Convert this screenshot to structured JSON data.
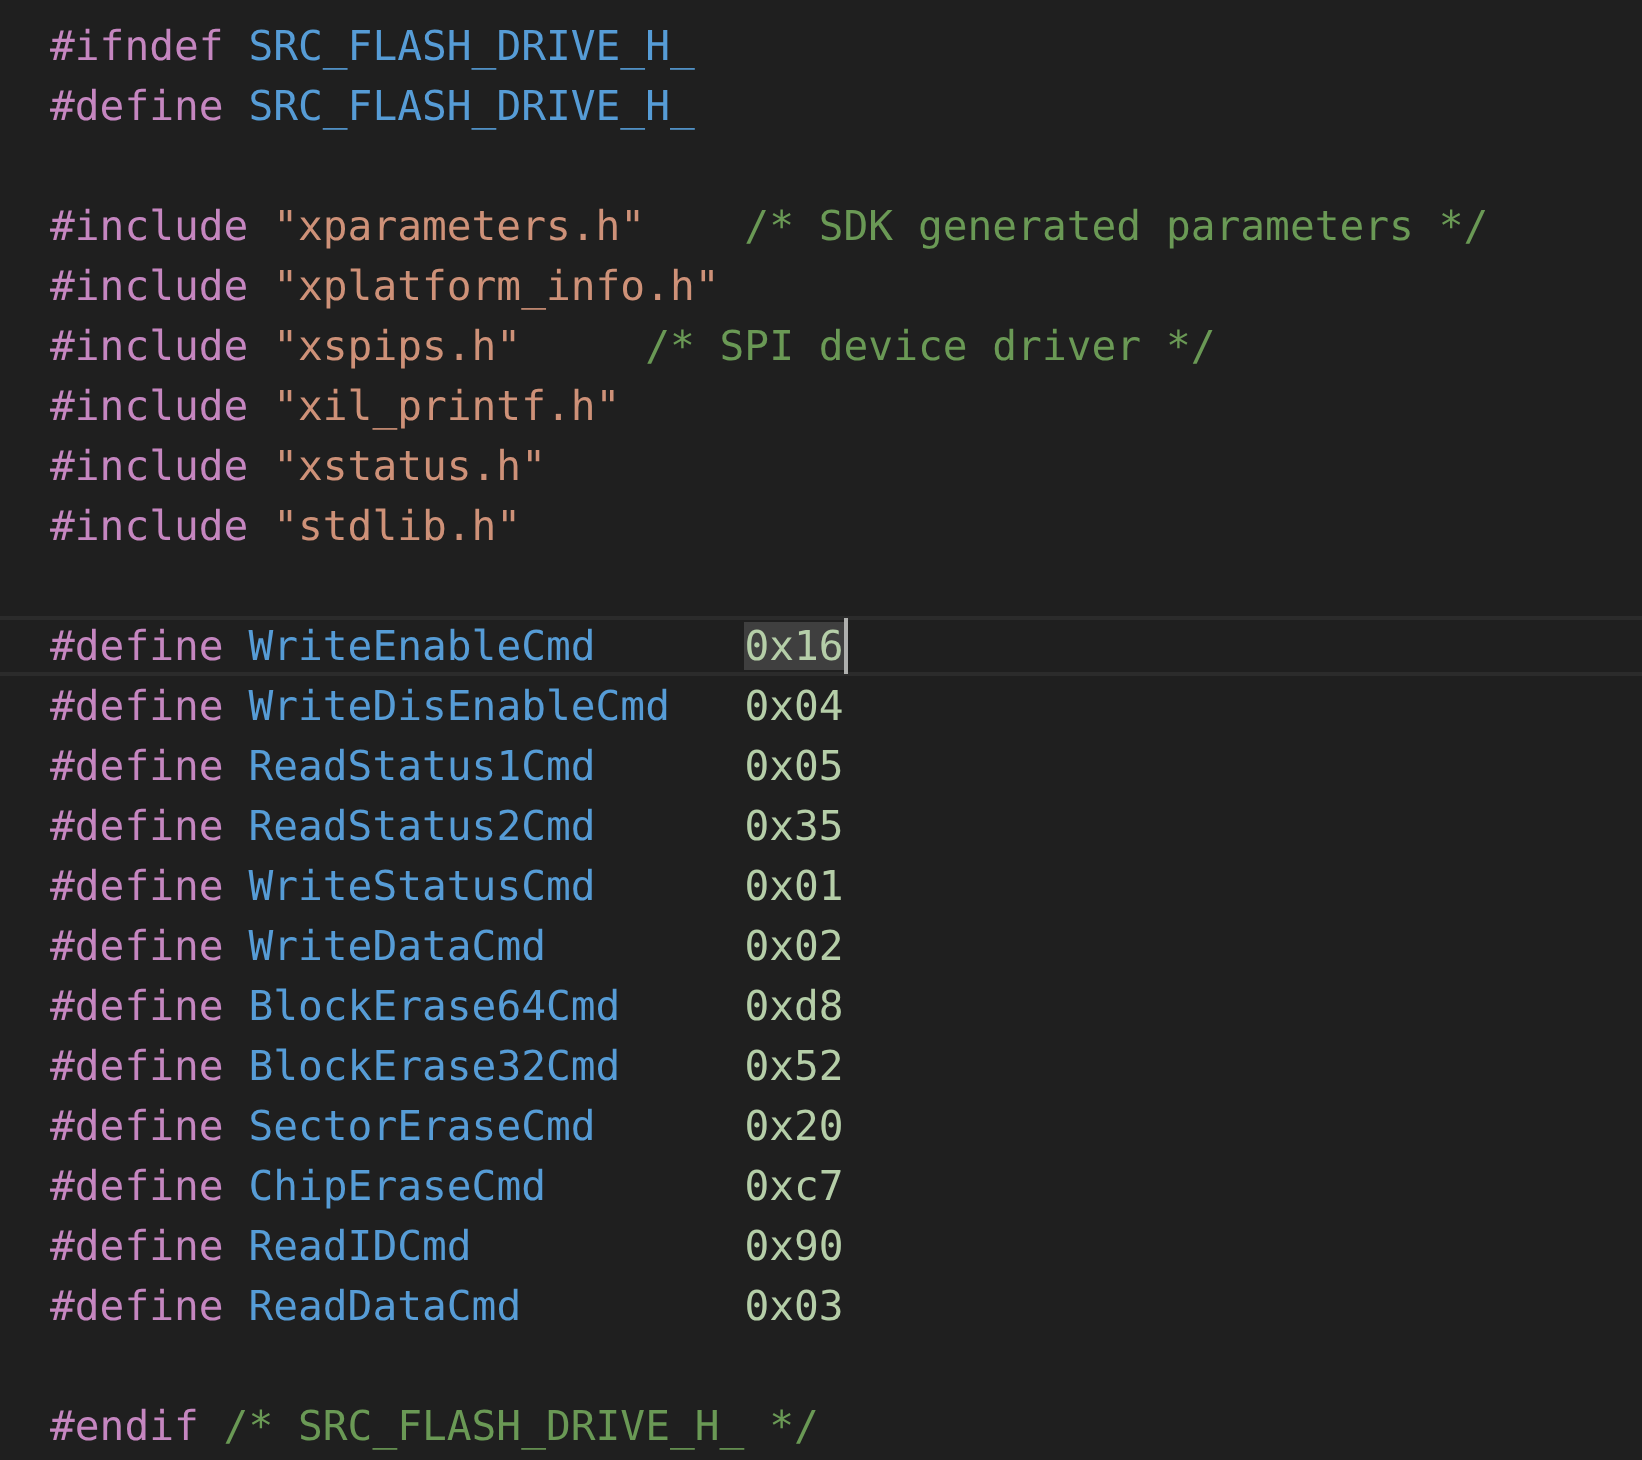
{
  "editor": {
    "lines": [
      {
        "kind": "code",
        "current": false,
        "tokens": [
          {
            "kind": "directive",
            "text": "#ifndef "
          },
          {
            "kind": "macro",
            "text": "SRC_FLASH_DRIVE_H_"
          }
        ]
      },
      {
        "kind": "code",
        "current": false,
        "tokens": [
          {
            "kind": "directive",
            "text": "#define "
          },
          {
            "kind": "macro",
            "text": "SRC_FLASH_DRIVE_H_"
          }
        ]
      },
      {
        "kind": "blank"
      },
      {
        "kind": "code",
        "current": false,
        "tokens": [
          {
            "kind": "directive",
            "text": "#include "
          },
          {
            "kind": "string",
            "text": "\"xparameters.h\"    "
          },
          {
            "kind": "comment",
            "text": "/* SDK generated parameters */"
          }
        ]
      },
      {
        "kind": "code",
        "current": false,
        "tokens": [
          {
            "kind": "directive",
            "text": "#include "
          },
          {
            "kind": "string",
            "text": "\"xplatform_info.h\""
          }
        ]
      },
      {
        "kind": "code",
        "current": false,
        "tokens": [
          {
            "kind": "directive",
            "text": "#include "
          },
          {
            "kind": "string",
            "text": "\"xspips.h\"     "
          },
          {
            "kind": "comment",
            "text": "/* SPI device driver */"
          }
        ]
      },
      {
        "kind": "code",
        "current": false,
        "tokens": [
          {
            "kind": "directive",
            "text": "#include "
          },
          {
            "kind": "string",
            "text": "\"xil_printf.h\""
          }
        ]
      },
      {
        "kind": "code",
        "current": false,
        "tokens": [
          {
            "kind": "directive",
            "text": "#include "
          },
          {
            "kind": "string",
            "text": "\"xstatus.h\""
          }
        ]
      },
      {
        "kind": "code",
        "current": false,
        "tokens": [
          {
            "kind": "directive",
            "text": "#include "
          },
          {
            "kind": "string",
            "text": "\"stdlib.h\""
          }
        ]
      },
      {
        "kind": "blank"
      },
      {
        "kind": "code",
        "current": true,
        "tokens": [
          {
            "kind": "directive",
            "text": "#define "
          },
          {
            "kind": "macro",
            "text": "WriteEnableCmd      "
          },
          {
            "kind": "number",
            "text": "0x16",
            "highlighted": true
          }
        ]
      },
      {
        "kind": "code",
        "current": false,
        "tokens": [
          {
            "kind": "directive",
            "text": "#define "
          },
          {
            "kind": "macro",
            "text": "WriteDisEnableCmd   "
          },
          {
            "kind": "number",
            "text": "0x04",
            "highlighted": false
          }
        ]
      },
      {
        "kind": "code",
        "current": false,
        "tokens": [
          {
            "kind": "directive",
            "text": "#define "
          },
          {
            "kind": "macro",
            "text": "ReadStatus1Cmd      "
          },
          {
            "kind": "number",
            "text": "0x05",
            "highlighted": false
          }
        ]
      },
      {
        "kind": "code",
        "current": false,
        "tokens": [
          {
            "kind": "directive",
            "text": "#define "
          },
          {
            "kind": "macro",
            "text": "ReadStatus2Cmd      "
          },
          {
            "kind": "number",
            "text": "0x35",
            "highlighted": false
          }
        ]
      },
      {
        "kind": "code",
        "current": false,
        "tokens": [
          {
            "kind": "directive",
            "text": "#define "
          },
          {
            "kind": "macro",
            "text": "WriteStatusCmd      "
          },
          {
            "kind": "number",
            "text": "0x01",
            "highlighted": false
          }
        ]
      },
      {
        "kind": "code",
        "current": false,
        "tokens": [
          {
            "kind": "directive",
            "text": "#define "
          },
          {
            "kind": "macro",
            "text": "WriteDataCmd        "
          },
          {
            "kind": "number",
            "text": "0x02",
            "highlighted": false
          }
        ]
      },
      {
        "kind": "code",
        "current": false,
        "tokens": [
          {
            "kind": "directive",
            "text": "#define "
          },
          {
            "kind": "macro",
            "text": "BlockErase64Cmd     "
          },
          {
            "kind": "number",
            "text": "0xd8",
            "highlighted": false
          }
        ]
      },
      {
        "kind": "code",
        "current": false,
        "tokens": [
          {
            "kind": "directive",
            "text": "#define "
          },
          {
            "kind": "macro",
            "text": "BlockErase32Cmd     "
          },
          {
            "kind": "number",
            "text": "0x52",
            "highlighted": false
          }
        ]
      },
      {
        "kind": "code",
        "current": false,
        "tokens": [
          {
            "kind": "directive",
            "text": "#define "
          },
          {
            "kind": "macro",
            "text": "SectorEraseCmd      "
          },
          {
            "kind": "number",
            "text": "0x20",
            "highlighted": false
          }
        ]
      },
      {
        "kind": "code",
        "current": false,
        "tokens": [
          {
            "kind": "directive",
            "text": "#define "
          },
          {
            "kind": "macro",
            "text": "ChipEraseCmd        "
          },
          {
            "kind": "number",
            "text": "0xc7",
            "highlighted": false
          }
        ]
      },
      {
        "kind": "code",
        "current": false,
        "tokens": [
          {
            "kind": "directive",
            "text": "#define "
          },
          {
            "kind": "macro",
            "text": "ReadIDCmd           "
          },
          {
            "kind": "number",
            "text": "0x90",
            "highlighted": false
          }
        ]
      },
      {
        "kind": "code",
        "current": false,
        "tokens": [
          {
            "kind": "directive",
            "text": "#define "
          },
          {
            "kind": "macro",
            "text": "ReadDataCmd         "
          },
          {
            "kind": "number",
            "text": "0x03",
            "highlighted": false
          }
        ]
      },
      {
        "kind": "blank"
      },
      {
        "kind": "code",
        "current": false,
        "tokens": [
          {
            "kind": "directive",
            "text": "#endif "
          },
          {
            "kind": "comment",
            "text": "/* SRC_FLASH_DRIVE_H_ */"
          }
        ]
      }
    ]
  }
}
